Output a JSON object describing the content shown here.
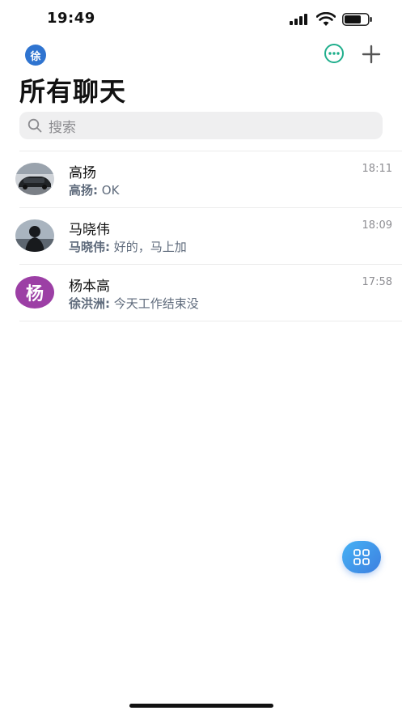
{
  "status_bar": {
    "time": "19:49"
  },
  "header": {
    "avatar_initial": "徐",
    "title": "所有聊天",
    "accent_color": "#2f74d0",
    "more_icon": "ellipsis-circle-icon",
    "add_icon": "plus-icon"
  },
  "search": {
    "placeholder": "搜索"
  },
  "chats": [
    {
      "name": "高扬",
      "time": "18:11",
      "sender": "高扬:",
      "message": " OK",
      "avatar_type": "photo-car"
    },
    {
      "name": "马晓伟",
      "time": "18:09",
      "sender": "马晓伟:",
      "message": " 好的，马上加",
      "avatar_type": "photo-person"
    },
    {
      "name": "杨本高",
      "time": "17:58",
      "sender": "徐洪洲:",
      "message": " 今天工作结束没",
      "avatar_text": "杨",
      "avatar_color": "#9c3fa5"
    }
  ],
  "fab": {
    "icon": "grid-apps-icon"
  }
}
